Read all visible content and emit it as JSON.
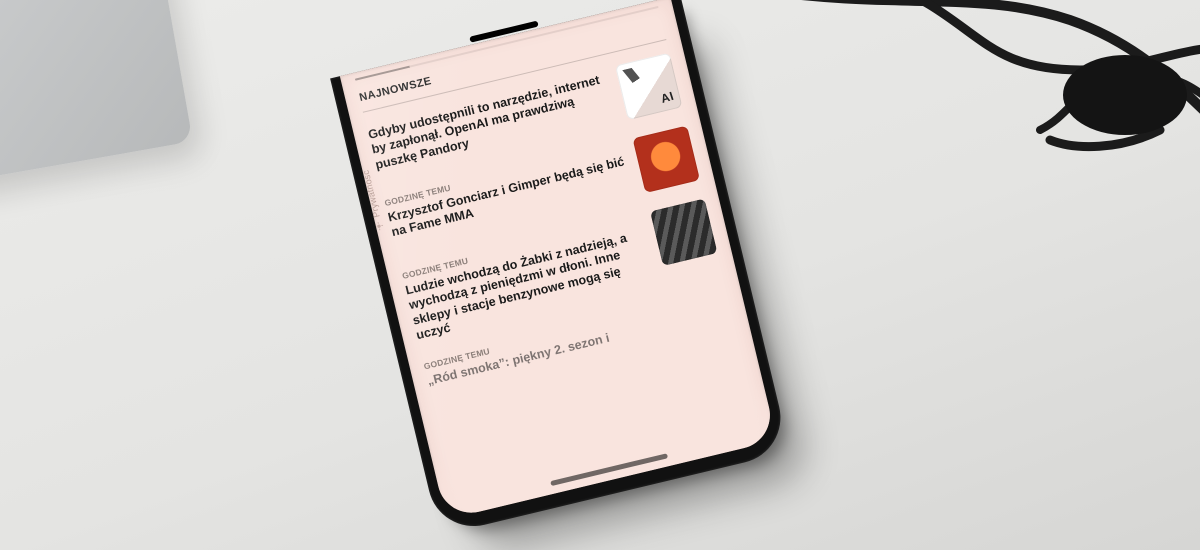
{
  "section_title_top": "NAJNOWSZE",
  "privacy_label": "Prywatność",
  "items": [
    {
      "timestamp": "",
      "headline": "Gdyby udostępnili to narzędzie, internet by zapłonął. OpenAI ma prawdziwą puszkę Pandory",
      "thumb": "ai"
    },
    {
      "timestamp": "GODZINĘ TEMU",
      "headline": "Krzysztof Gonciarz i Gimper będą się bić na Fame MMA",
      "thumb": "orange"
    },
    {
      "timestamp": "GODZINĘ TEMU",
      "headline": "Ludzie wchodzą do Żabki z nadzieją, a wychodzą z pieniędzmi w dłoni. Inne sklepy i stacje benzynowe mogą się uczyć",
      "thumb": "bw"
    }
  ],
  "cut_item": {
    "timestamp": "GODZINĘ TEMU",
    "headline": "„Ród smoka”: piękny 2. sezon i"
  }
}
